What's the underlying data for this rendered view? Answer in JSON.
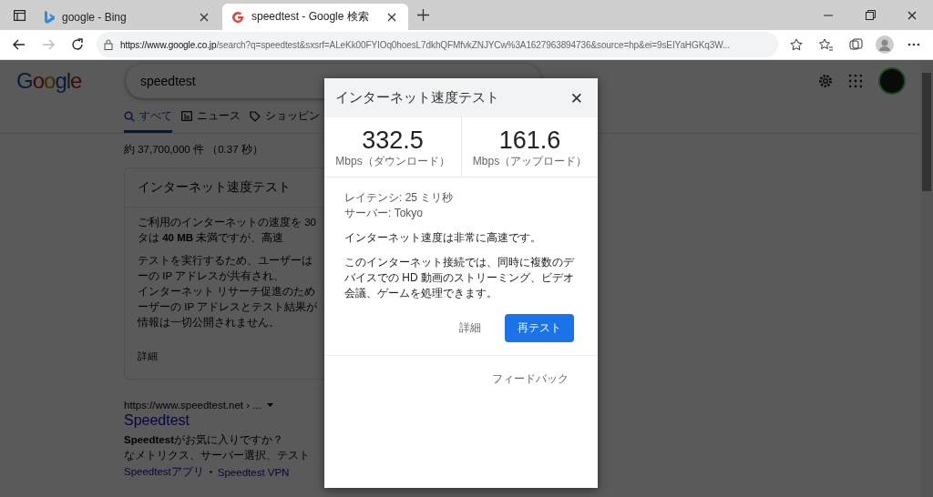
{
  "browser": {
    "tabs": [
      {
        "title": "google - Bing",
        "selected": false
      },
      {
        "title": "speedtest - Google 検索",
        "selected": true
      }
    ],
    "url_host": "https://www.google.co.jp",
    "url_path": "/search?q=speedtest&sxsrf=ALeKk00FYIOq0hoesL7dkhQFMfvkZNJYCw%3A1627963894736&source=hp&ei=9sEIYaHGKq3W..."
  },
  "page": {
    "logo": "Google",
    "search_value": "speedtest",
    "nav": [
      {
        "label": "すべて",
        "selected": true
      },
      {
        "label": "ニュース",
        "selected": false
      },
      {
        "label": "ショッピン",
        "selected": false
      }
    ],
    "result_stats": "約 37,700,000 件 （0.37 秒）",
    "card": {
      "title": "インターネット速度テスト",
      "paragraphs": [
        [
          "ご利用のインターネットの速度を 30",
          "タは **40 MB** 未満ですが、高速"
        ],
        [
          "テストを実行するため、ユーザーは",
          "ーの IP アドレスが共有され、",
          "インターネット リサーチ促進のため",
          "ーザーの IP アドレスとテスト結果が",
          "情報は一切公開されません。"
        ]
      ],
      "more": "詳細"
    },
    "result": {
      "cite": "https://www.speedtest.net › ...",
      "title": "Speedtest",
      "lines": [
        "**Speedtest**がお気に入りですか？",
        "なメトリクス、サーバー選択、テスト"
      ],
      "sitelinks": [
        "Speedtestアプリ",
        "Speedtest VPN"
      ]
    }
  },
  "dialog": {
    "title": "インターネット速度テスト",
    "close": "✕",
    "metrics": [
      {
        "value": "332.5",
        "label": "Mbps（ダウンロード）"
      },
      {
        "value": "161.6",
        "label": "Mbps（アップロード）"
      }
    ],
    "details": [
      "レイテンシ: 25 ミリ秒",
      "サーバー: Tokyo"
    ],
    "summary": "インターネット速度は非常に高速です。",
    "description": "このインターネット接続では、同時に複数のデバイスでの HD 動画のストリーミング、ビデオ会議、ゲームを処理できます。",
    "details_link": "詳細",
    "retest": "再テスト",
    "feedback": "フィードバック"
  }
}
